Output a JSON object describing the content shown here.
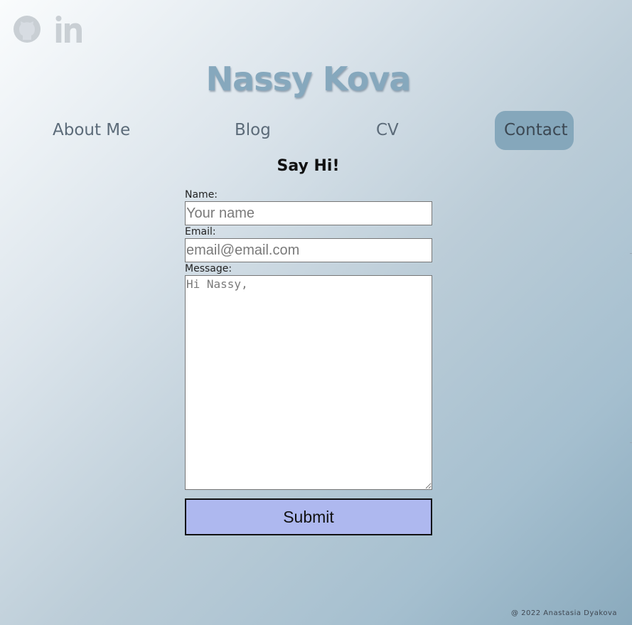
{
  "social": {
    "github_icon": "github-icon",
    "linkedin_icon": "linkedin-icon",
    "icon_color": "#c9cfd4"
  },
  "header": {
    "title": "Nassy Kova"
  },
  "nav": {
    "items": [
      {
        "label": "About Me",
        "active": false
      },
      {
        "label": "Blog",
        "active": false
      },
      {
        "label": "CV",
        "active": false
      },
      {
        "label": "Contact",
        "active": true
      }
    ],
    "active_color": "#85a7bb"
  },
  "contact": {
    "heading": "Say Hi!",
    "name_label": "Name:",
    "name_placeholder": "Your name",
    "name_value": "",
    "email_label": "Email:",
    "email_placeholder": "email@email.com",
    "email_value": "",
    "message_label": "Message:",
    "message_placeholder": "Hi Nassy,",
    "message_value": "",
    "submit_label": "Submit",
    "submit_color": "#aeb8ef"
  },
  "footer": {
    "text": "@ 2022 Anastasia Dyakova"
  }
}
